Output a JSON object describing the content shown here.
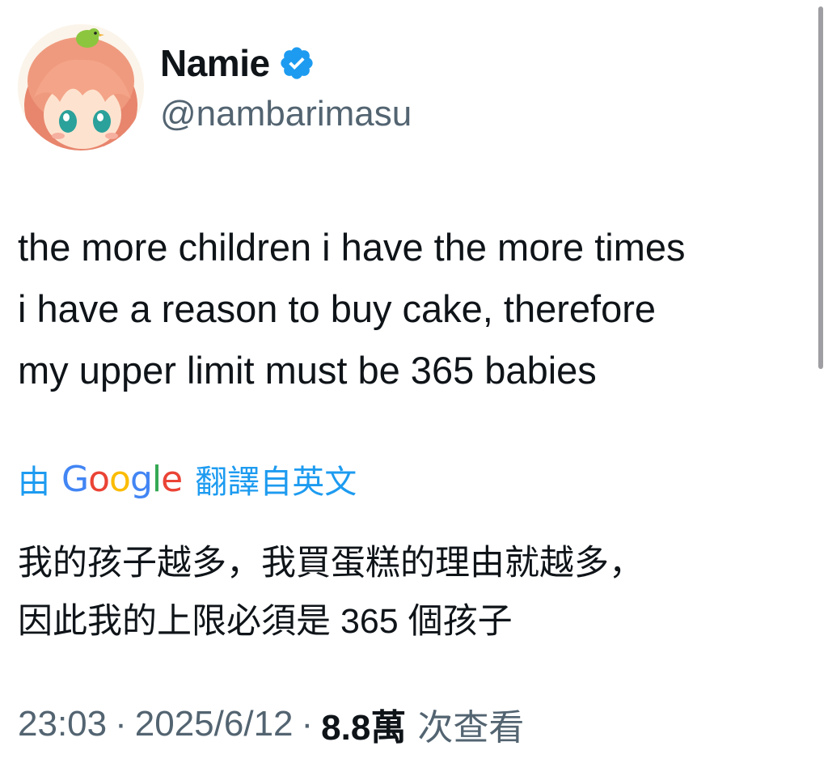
{
  "user": {
    "display_name": "Namie",
    "handle": "@nambarimasu",
    "verified_icon": "verified-badge-icon",
    "avatar_icon": "anime-avatar"
  },
  "tweet": {
    "text": "the more children i have the more times\ni have a reason to buy cake, therefore\nmy upper limit must be 365 babies"
  },
  "translation": {
    "prefix": "由",
    "provider": "Google",
    "suffix": "翻譯自英文",
    "translated_text": "我的孩子越多，我買蛋糕的理由就越多，\n因此我的上限必須是 365 個孩子"
  },
  "meta": {
    "time": "23:03",
    "dot1": "·",
    "date": "2025/6/12",
    "dot2": "·",
    "views_count": "8.8萬",
    "views_label": "次查看"
  },
  "colors": {
    "link_blue": "#1d9bf0",
    "secondary_text": "#536471",
    "primary_text": "#0f1419"
  }
}
